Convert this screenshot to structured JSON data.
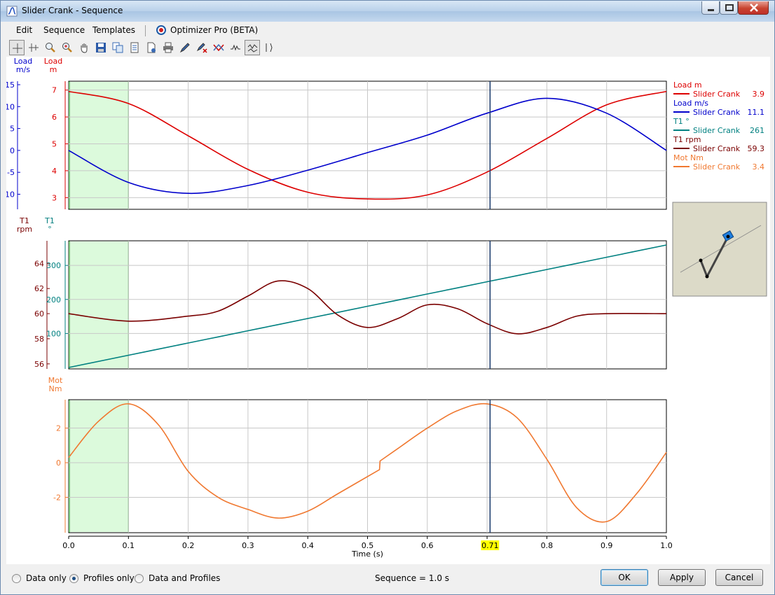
{
  "window": {
    "title": "Slider Crank - Sequence",
    "minimize_icon": "minimize-icon",
    "maximize_icon": "maximize-icon",
    "close_icon": "close-icon"
  },
  "menu": {
    "edit": "Edit",
    "sequence": "Sequence",
    "templates": "Templates",
    "optimizer": "Optimizer Pro (BETA)"
  },
  "toolbar": {
    "icons": [
      "crosshair-icon",
      "delta-cursor-icon",
      "zoom-in-icon",
      "zoom-box-icon",
      "pan-hand-icon",
      "save-icon",
      "copy-icon",
      "copy-data-icon",
      "export-icon",
      "print-icon",
      "pen-icon",
      "eraser-pen-icon",
      "multi-trace-icon",
      "dots-trace-icon",
      "profile-active-icon",
      "split-icon"
    ]
  },
  "top_plot": {
    "axis_left": {
      "line1": "Load",
      "line2": "m/s",
      "color": "#0000cc",
      "ticks": [
        "15",
        "10",
        "5",
        "0",
        "-5",
        "-10"
      ]
    },
    "axis_right": {
      "line1": "Load",
      "line2": "m",
      "color": "#dd0000",
      "ticks": [
        "7",
        "6",
        "5",
        "4",
        "3"
      ]
    }
  },
  "mid_plot": {
    "axis_left": {
      "line1": "T1",
      "line2": "rpm",
      "color": "#7a0000",
      "ticks": [
        "64",
        "62",
        "60",
        "58",
        "56"
      ]
    },
    "axis_right": {
      "line1": "T1",
      "line2": "°",
      "color": "#008080",
      "ticks": [
        "300",
        "200",
        "100"
      ]
    }
  },
  "bot_plot": {
    "axis_right": {
      "line1": "Mot",
      "line2": "Nm",
      "color": "#f07830",
      "ticks": [
        "2",
        "0",
        "-2"
      ]
    }
  },
  "x_axis": {
    "label": "Time (s)",
    "ticks": [
      "0.0",
      "0.1",
      "0.2",
      "0.3",
      "0.4",
      "0.5",
      "0.6",
      "0.7",
      "0.8",
      "0.9",
      "1.0"
    ],
    "cursor_value": "0.71",
    "cursor_color": "#ffff00"
  },
  "legend": [
    {
      "title": "Load m",
      "name": "Slider Crank",
      "value": "3.9",
      "color": "#dd0000"
    },
    {
      "title": "Load m/s",
      "name": "Slider Crank",
      "value": "11.1",
      "color": "#0000cc"
    },
    {
      "title": "T1 °",
      "name": "Slider Crank",
      "value": "261",
      "color": "#008080"
    },
    {
      "title": "T1 rpm",
      "name": "Slider Crank",
      "value": "59.3",
      "color": "#7a0000"
    },
    {
      "title": "Mot Nm",
      "name": "Slider Crank",
      "value": "3.4",
      "color": "#f07830"
    }
  ],
  "chart_data": [
    {
      "type": "line",
      "x": [
        0.0,
        0.1,
        0.2,
        0.3,
        0.4,
        0.5,
        0.6,
        0.7,
        0.8,
        0.9,
        1.0
      ],
      "series": [
        {
          "name": "Load m",
          "axis": "right",
          "values": [
            6.95,
            6.5,
            5.3,
            4.05,
            3.2,
            2.95,
            3.1,
            3.95,
            5.2,
            6.45,
            6.95
          ]
        },
        {
          "name": "Load m/s",
          "axis": "left",
          "values": [
            0.0,
            -7.3,
            -9.8,
            -8.0,
            -4.5,
            -0.5,
            3.5,
            8.5,
            11.9,
            8.5,
            0.0
          ]
        }
      ],
      "ylim_left": [
        -12,
        15
      ],
      "ylim_right": [
        2.8,
        7.2
      ]
    },
    {
      "type": "line",
      "x": [
        0.0,
        0.1,
        0.2,
        0.25,
        0.3,
        0.35,
        0.4,
        0.45,
        0.5,
        0.55,
        0.6,
        0.65,
        0.7,
        0.75,
        0.8,
        0.85,
        0.9,
        1.0
      ],
      "series": [
        {
          "name": "T1 rpm",
          "axis": "left",
          "values": [
            60.0,
            59.4,
            59.8,
            60.2,
            61.4,
            62.6,
            62.0,
            59.9,
            58.9,
            59.6,
            60.7,
            60.4,
            59.2,
            58.4,
            58.9,
            59.8,
            60.0,
            60.0
          ]
        },
        {
          "name": "T1 °",
          "axis": "right",
          "values": [
            0,
            36,
            72,
            90,
            108,
            126,
            144,
            162,
            180,
            198,
            216,
            234,
            252,
            270,
            288,
            306,
            324,
            360
          ]
        }
      ],
      "ylim_left": [
        55.6,
        65.8
      ],
      "ylim_right": [
        0,
        360
      ]
    },
    {
      "type": "line",
      "x": [
        0.0,
        0.05,
        0.1,
        0.15,
        0.2,
        0.25,
        0.3,
        0.35,
        0.4,
        0.45,
        0.52,
        0.521,
        0.55,
        0.6,
        0.65,
        0.7,
        0.75,
        0.8,
        0.85,
        0.9,
        0.95,
        1.0
      ],
      "series": [
        {
          "name": "Mot Nm",
          "axis": "left",
          "values": [
            0.3,
            2.4,
            3.4,
            2.2,
            -0.5,
            -2.0,
            -2.7,
            -3.2,
            -2.8,
            -1.8,
            -0.4,
            0.1,
            0.8,
            2.0,
            3.0,
            3.4,
            2.6,
            0.2,
            -2.6,
            -3.4,
            -1.8,
            0.6
          ]
        }
      ],
      "ylim": [
        -3.6,
        3.6
      ]
    }
  ],
  "shaded_region": {
    "x_start": 0.0,
    "x_end": 0.1
  },
  "cursor_time": 0.705,
  "radios": [
    {
      "label": "Data only",
      "checked": false
    },
    {
      "label": "Profiles only",
      "checked": true
    },
    {
      "label": "Data and Profiles",
      "checked": false
    }
  ],
  "status": "Sequence = 1.0 s",
  "buttons": {
    "ok": "OK",
    "apply": "Apply",
    "cancel": "Cancel"
  }
}
